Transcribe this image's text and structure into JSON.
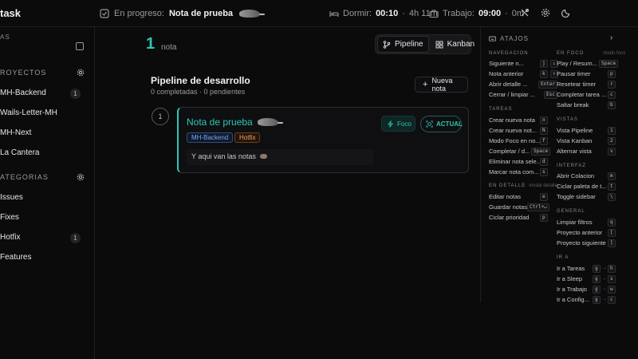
{
  "header": {
    "brand": "task",
    "in_progress_label": "En progreso:",
    "in_progress_title": "Nota de prueba",
    "sleep_label": "Dormir:",
    "sleep_time": "00:10",
    "sleep_remaining": "4h 11m",
    "work_label": "Trabajo:",
    "work_time": "09:00",
    "work_elapsed": "0m",
    "separator": "·"
  },
  "sidebar": {
    "top_label": "AS",
    "projects_heading": "ROYECTOS",
    "projects": [
      {
        "label": "MH-Backend",
        "count": "1"
      },
      {
        "label": "Wails-Letter-MH",
        "count": ""
      },
      {
        "label": "MH-Next",
        "count": ""
      },
      {
        "label": "La Cantera",
        "count": ""
      }
    ],
    "categories_heading": "ATEGORIAS",
    "categories": [
      {
        "label": "Issues",
        "count": ""
      },
      {
        "label": "Fixes",
        "count": ""
      },
      {
        "label": "Hotfix",
        "count": "1"
      },
      {
        "label": "Features",
        "count": ""
      }
    ]
  },
  "main": {
    "note_count": "1",
    "note_count_label": "nota",
    "view_pipeline": "Pipeline",
    "view_kanban": "Kanban",
    "pipeline_title": "Pipeline de desarrollo",
    "pipeline_summary": "0 completadas · 0 pendientes",
    "new_note": "Nueva nota",
    "card": {
      "step": "1",
      "title": "Nota de prueba",
      "tags": [
        "MH-Backend",
        "Hotfix"
      ],
      "body": "Y aqui van las notas",
      "focus_label": "Foco",
      "current_label": "ACTUAL"
    }
  },
  "shortcuts": {
    "title": "ATAJOS",
    "groups": {
      "navegacion": {
        "title": "NAVEGACION",
        "rows": [
          {
            "label": "Siguiente n...",
            "keys": [
              "j",
              "↓"
            ]
          },
          {
            "label": "Nota anterior",
            "keys": [
              "k",
              "↑"
            ]
          },
          {
            "label": "Abrir detalle ...",
            "keys": [
              "Enter"
            ]
          },
          {
            "label": "Cerrar / limpiar ...",
            "keys": [
              "Esc"
            ]
          }
        ]
      },
      "tareas": {
        "title": "TAREAS",
        "rows": [
          {
            "label": "Crear nueva nota",
            "keys": [
              "n"
            ]
          },
          {
            "label": "Crear nueva not...",
            "keys": [
              "N"
            ]
          },
          {
            "label": "Modo Foco en no...",
            "keys": [
              "f"
            ]
          },
          {
            "label": "Completar / d...",
            "keys": [
              "Space"
            ]
          },
          {
            "label": "Eliminar nota sele...",
            "keys": [
              "d"
            ]
          },
          {
            "label": "Marcar nota com...",
            "keys": [
              "s"
            ]
          }
        ]
      },
      "en_detalle": {
        "title": "EN DETALLE",
        "hint": "modal detalle",
        "rows": [
          {
            "label": "Editar notas",
            "keys": [
              "e"
            ]
          },
          {
            "label": "Guardar notas",
            "keys": [
              "Ctrl+↵"
            ]
          },
          {
            "label": "Ciclar prioridad",
            "keys": [
              "p"
            ]
          }
        ]
      },
      "en_foco": {
        "title": "EN FOCO",
        "hint": "modo foco",
        "rows": [
          {
            "label": "Play / Resum...",
            "keys": [
              "Space"
            ]
          },
          {
            "label": "Pausar timer",
            "keys": [
              "p"
            ]
          },
          {
            "label": "Resetear timer",
            "keys": [
              "r"
            ]
          },
          {
            "label": "Completar tarea ...",
            "keys": [
              "c"
            ]
          },
          {
            "label": "Saltar break",
            "keys": [
              "b"
            ]
          }
        ]
      },
      "vistas": {
        "title": "VISTAS",
        "rows": [
          {
            "label": "Vista Pipeline",
            "keys": [
              "1"
            ]
          },
          {
            "label": "Vista Kanban",
            "keys": [
              "2"
            ]
          },
          {
            "label": "Alternar vista",
            "keys": [
              "v"
            ]
          }
        ]
      },
      "interfaz": {
        "title": "INTERFAZ",
        "rows": [
          {
            "label": "Abrir Colacion",
            "keys": [
              "m"
            ]
          },
          {
            "label": "Ciclar paleta de t...",
            "keys": [
              "t"
            ]
          },
          {
            "label": "Toggle sidebar",
            "keys": [
              "\\"
            ]
          }
        ]
      },
      "general": {
        "title": "GENERAL",
        "rows": [
          {
            "label": "Limpiar filtros",
            "keys": [
              "q"
            ]
          },
          {
            "label": "Proyecto anterior",
            "keys": [
              "["
            ]
          },
          {
            "label": "Proyecto siguiente",
            "keys": [
              "]"
            ]
          }
        ]
      },
      "ir_a": {
        "title": "IR A",
        "rows": [
          {
            "label": "Ir a Tareas",
            "keys": [
              "g",
              "h"
            ]
          },
          {
            "label": "Ir a Sleep",
            "keys": [
              "g",
              "s"
            ]
          },
          {
            "label": "Ir a Trabajo",
            "keys": [
              "g",
              "w"
            ]
          },
          {
            "label": "Ir a Config...",
            "keys": [
              "g",
              "c"
            ]
          }
        ]
      },
      "key_join": "→"
    }
  },
  "colors": {
    "accent": "#2cc7b6",
    "background": "#0b0b0c",
    "tag_blue": "#6ea8ff",
    "tag_orange": "#ff9c55"
  }
}
